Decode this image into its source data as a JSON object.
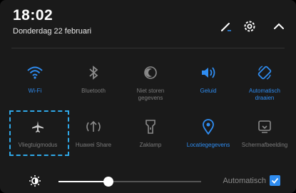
{
  "status": {
    "time": "18:02",
    "date": "Donderdag 22 februari"
  },
  "header_icons": [
    "edit-icon",
    "gear-icon",
    "chevron-up-icon"
  ],
  "colors": {
    "active": "#2f8cf0",
    "inactive": "#7b7b7b",
    "highlight": "#2fa8e8"
  },
  "toggles_row1": [
    {
      "icon": "wifi-icon",
      "label": "Wi-Fi",
      "active": true
    },
    {
      "icon": "bluetooth-icon",
      "label": "Bluetooth",
      "active": false
    },
    {
      "icon": "do-not-disturb-icon",
      "label": "Niet storen\ngegevens",
      "active": false
    },
    {
      "icon": "sound-icon",
      "label": "Geluid",
      "active": true
    },
    {
      "icon": "auto-rotate-icon",
      "label": "Automatisch\ndraaien",
      "active": true
    }
  ],
  "toggles_row2": [
    {
      "icon": "airplane-icon",
      "label": "Vliegtuigmodus",
      "active": false
    },
    {
      "icon": "huawei-share-icon",
      "label": "Huawei Share",
      "active": false
    },
    {
      "icon": "flashlight-icon",
      "label": "Zaklamp",
      "active": false
    },
    {
      "icon": "location-icon",
      "label": "Locatiegegevens",
      "active": true
    },
    {
      "icon": "screenshot-icon",
      "label": "Schermafbeelding",
      "active": false
    }
  ],
  "brightness": {
    "level": 0.35,
    "auto_label": "Automatisch",
    "auto_checked": true
  }
}
